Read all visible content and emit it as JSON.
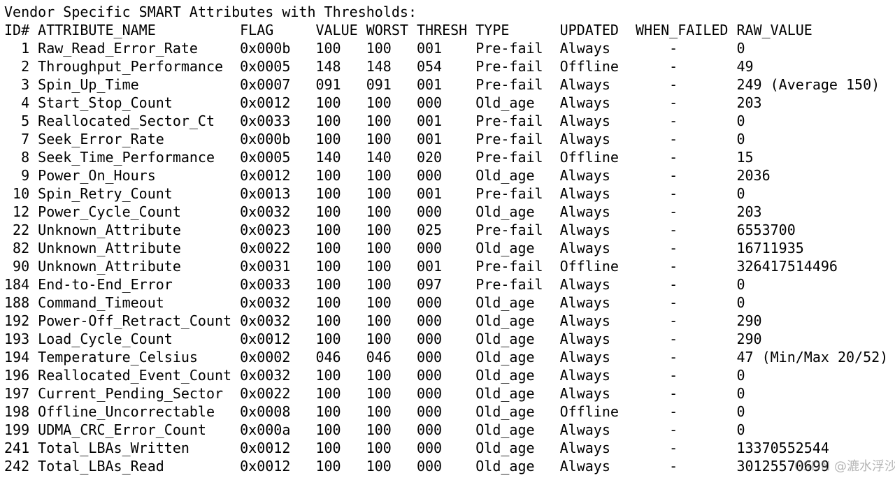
{
  "title": "Vendor Specific SMART Attributes with Thresholds:",
  "columns": [
    "ID#",
    "ATTRIBUTE_NAME",
    "FLAG",
    "VALUE",
    "WORST",
    "THRESH",
    "TYPE",
    "UPDATED",
    "WHEN_FAILED",
    "RAW_VALUE"
  ],
  "rows": [
    {
      "id": "1",
      "name": "Raw_Read_Error_Rate",
      "flag": "0x000b",
      "value": "100",
      "worst": "100",
      "thresh": "001",
      "type": "Pre-fail",
      "updated": "Always",
      "when_failed": "-",
      "raw": "0"
    },
    {
      "id": "2",
      "name": "Throughput_Performance",
      "flag": "0x0005",
      "value": "148",
      "worst": "148",
      "thresh": "054",
      "type": "Pre-fail",
      "updated": "Offline",
      "when_failed": "-",
      "raw": "49"
    },
    {
      "id": "3",
      "name": "Spin_Up_Time",
      "flag": "0x0007",
      "value": "091",
      "worst": "091",
      "thresh": "001",
      "type": "Pre-fail",
      "updated": "Always",
      "when_failed": "-",
      "raw": "249 (Average 150)"
    },
    {
      "id": "4",
      "name": "Start_Stop_Count",
      "flag": "0x0012",
      "value": "100",
      "worst": "100",
      "thresh": "000",
      "type": "Old_age",
      "updated": "Always",
      "when_failed": "-",
      "raw": "203"
    },
    {
      "id": "5",
      "name": "Reallocated_Sector_Ct",
      "flag": "0x0033",
      "value": "100",
      "worst": "100",
      "thresh": "001",
      "type": "Pre-fail",
      "updated": "Always",
      "when_failed": "-",
      "raw": "0"
    },
    {
      "id": "7",
      "name": "Seek_Error_Rate",
      "flag": "0x000b",
      "value": "100",
      "worst": "100",
      "thresh": "001",
      "type": "Pre-fail",
      "updated": "Always",
      "when_failed": "-",
      "raw": "0"
    },
    {
      "id": "8",
      "name": "Seek_Time_Performance",
      "flag": "0x0005",
      "value": "140",
      "worst": "140",
      "thresh": "020",
      "type": "Pre-fail",
      "updated": "Offline",
      "when_failed": "-",
      "raw": "15"
    },
    {
      "id": "9",
      "name": "Power_On_Hours",
      "flag": "0x0012",
      "value": "100",
      "worst": "100",
      "thresh": "000",
      "type": "Old_age",
      "updated": "Always",
      "when_failed": "-",
      "raw": "2036"
    },
    {
      "id": "10",
      "name": "Spin_Retry_Count",
      "flag": "0x0013",
      "value": "100",
      "worst": "100",
      "thresh": "001",
      "type": "Pre-fail",
      "updated": "Always",
      "when_failed": "-",
      "raw": "0"
    },
    {
      "id": "12",
      "name": "Power_Cycle_Count",
      "flag": "0x0032",
      "value": "100",
      "worst": "100",
      "thresh": "000",
      "type": "Old_age",
      "updated": "Always",
      "when_failed": "-",
      "raw": "203"
    },
    {
      "id": "22",
      "name": "Unknown_Attribute",
      "flag": "0x0023",
      "value": "100",
      "worst": "100",
      "thresh": "025",
      "type": "Pre-fail",
      "updated": "Always",
      "when_failed": "-",
      "raw": "6553700"
    },
    {
      "id": "82",
      "name": "Unknown_Attribute",
      "flag": "0x0022",
      "value": "100",
      "worst": "100",
      "thresh": "000",
      "type": "Old_age",
      "updated": "Always",
      "when_failed": "-",
      "raw": "16711935"
    },
    {
      "id": "90",
      "name": "Unknown_Attribute",
      "flag": "0x0031",
      "value": "100",
      "worst": "100",
      "thresh": "001",
      "type": "Pre-fail",
      "updated": "Offline",
      "when_failed": "-",
      "raw": "326417514496"
    },
    {
      "id": "184",
      "name": "End-to-End_Error",
      "flag": "0x0033",
      "value": "100",
      "worst": "100",
      "thresh": "097",
      "type": "Pre-fail",
      "updated": "Always",
      "when_failed": "-",
      "raw": "0"
    },
    {
      "id": "188",
      "name": "Command_Timeout",
      "flag": "0x0032",
      "value": "100",
      "worst": "100",
      "thresh": "000",
      "type": "Old_age",
      "updated": "Always",
      "when_failed": "-",
      "raw": "0"
    },
    {
      "id": "192",
      "name": "Power-Off_Retract_Count",
      "flag": "0x0032",
      "value": "100",
      "worst": "100",
      "thresh": "000",
      "type": "Old_age",
      "updated": "Always",
      "when_failed": "-",
      "raw": "290"
    },
    {
      "id": "193",
      "name": "Load_Cycle_Count",
      "flag": "0x0012",
      "value": "100",
      "worst": "100",
      "thresh": "000",
      "type": "Old_age",
      "updated": "Always",
      "when_failed": "-",
      "raw": "290"
    },
    {
      "id": "194",
      "name": "Temperature_Celsius",
      "flag": "0x0002",
      "value": "046",
      "worst": "046",
      "thresh": "000",
      "type": "Old_age",
      "updated": "Always",
      "when_failed": "-",
      "raw": "47 (Min/Max 20/52)"
    },
    {
      "id": "196",
      "name": "Reallocated_Event_Count",
      "flag": "0x0032",
      "value": "100",
      "worst": "100",
      "thresh": "000",
      "type": "Old_age",
      "updated": "Always",
      "when_failed": "-",
      "raw": "0"
    },
    {
      "id": "197",
      "name": "Current_Pending_Sector",
      "flag": "0x0022",
      "value": "100",
      "worst": "100",
      "thresh": "000",
      "type": "Old_age",
      "updated": "Always",
      "when_failed": "-",
      "raw": "0"
    },
    {
      "id": "198",
      "name": "Offline_Uncorrectable",
      "flag": "0x0008",
      "value": "100",
      "worst": "100",
      "thresh": "000",
      "type": "Old_age",
      "updated": "Offline",
      "when_failed": "-",
      "raw": "0"
    },
    {
      "id": "199",
      "name": "UDMA_CRC_Error_Count",
      "flag": "0x000a",
      "value": "100",
      "worst": "100",
      "thresh": "000",
      "type": "Old_age",
      "updated": "Always",
      "when_failed": "-",
      "raw": "0"
    },
    {
      "id": "241",
      "name": "Total_LBAs_Written",
      "flag": "0x0012",
      "value": "100",
      "worst": "100",
      "thresh": "000",
      "type": "Old_age",
      "updated": "Always",
      "when_failed": "-",
      "raw": "13370552544"
    },
    {
      "id": "242",
      "name": "Total_LBAs_Read",
      "flag": "0x0012",
      "value": "100",
      "worst": "100",
      "thresh": "000",
      "type": "Old_age",
      "updated": "Always",
      "when_failed": "-",
      "raw": "30125570699"
    }
  ],
  "watermark": "CSDN @漉水浮沙"
}
